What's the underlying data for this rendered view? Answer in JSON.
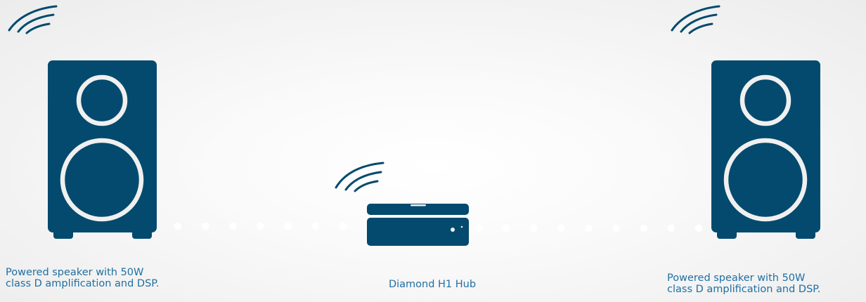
{
  "colors": {
    "device": "#034a6e",
    "device_detail": "#f0f0f0",
    "dot": "#ffffff",
    "caption_text": "#1f6fa2"
  },
  "icons": {
    "wifi": "wifi-signal-icon",
    "speaker": "speaker-icon",
    "hub": "hub-device-icon"
  },
  "left_speaker": {
    "caption_line1": "Powered speaker with 50W",
    "caption_line2": "class D amplification and DSP."
  },
  "hub": {
    "caption": "Diamond H1 Hub"
  },
  "right_speaker": {
    "caption_line1": "Powered speaker with 50W",
    "caption_line2": "class D amplification and DSP."
  }
}
